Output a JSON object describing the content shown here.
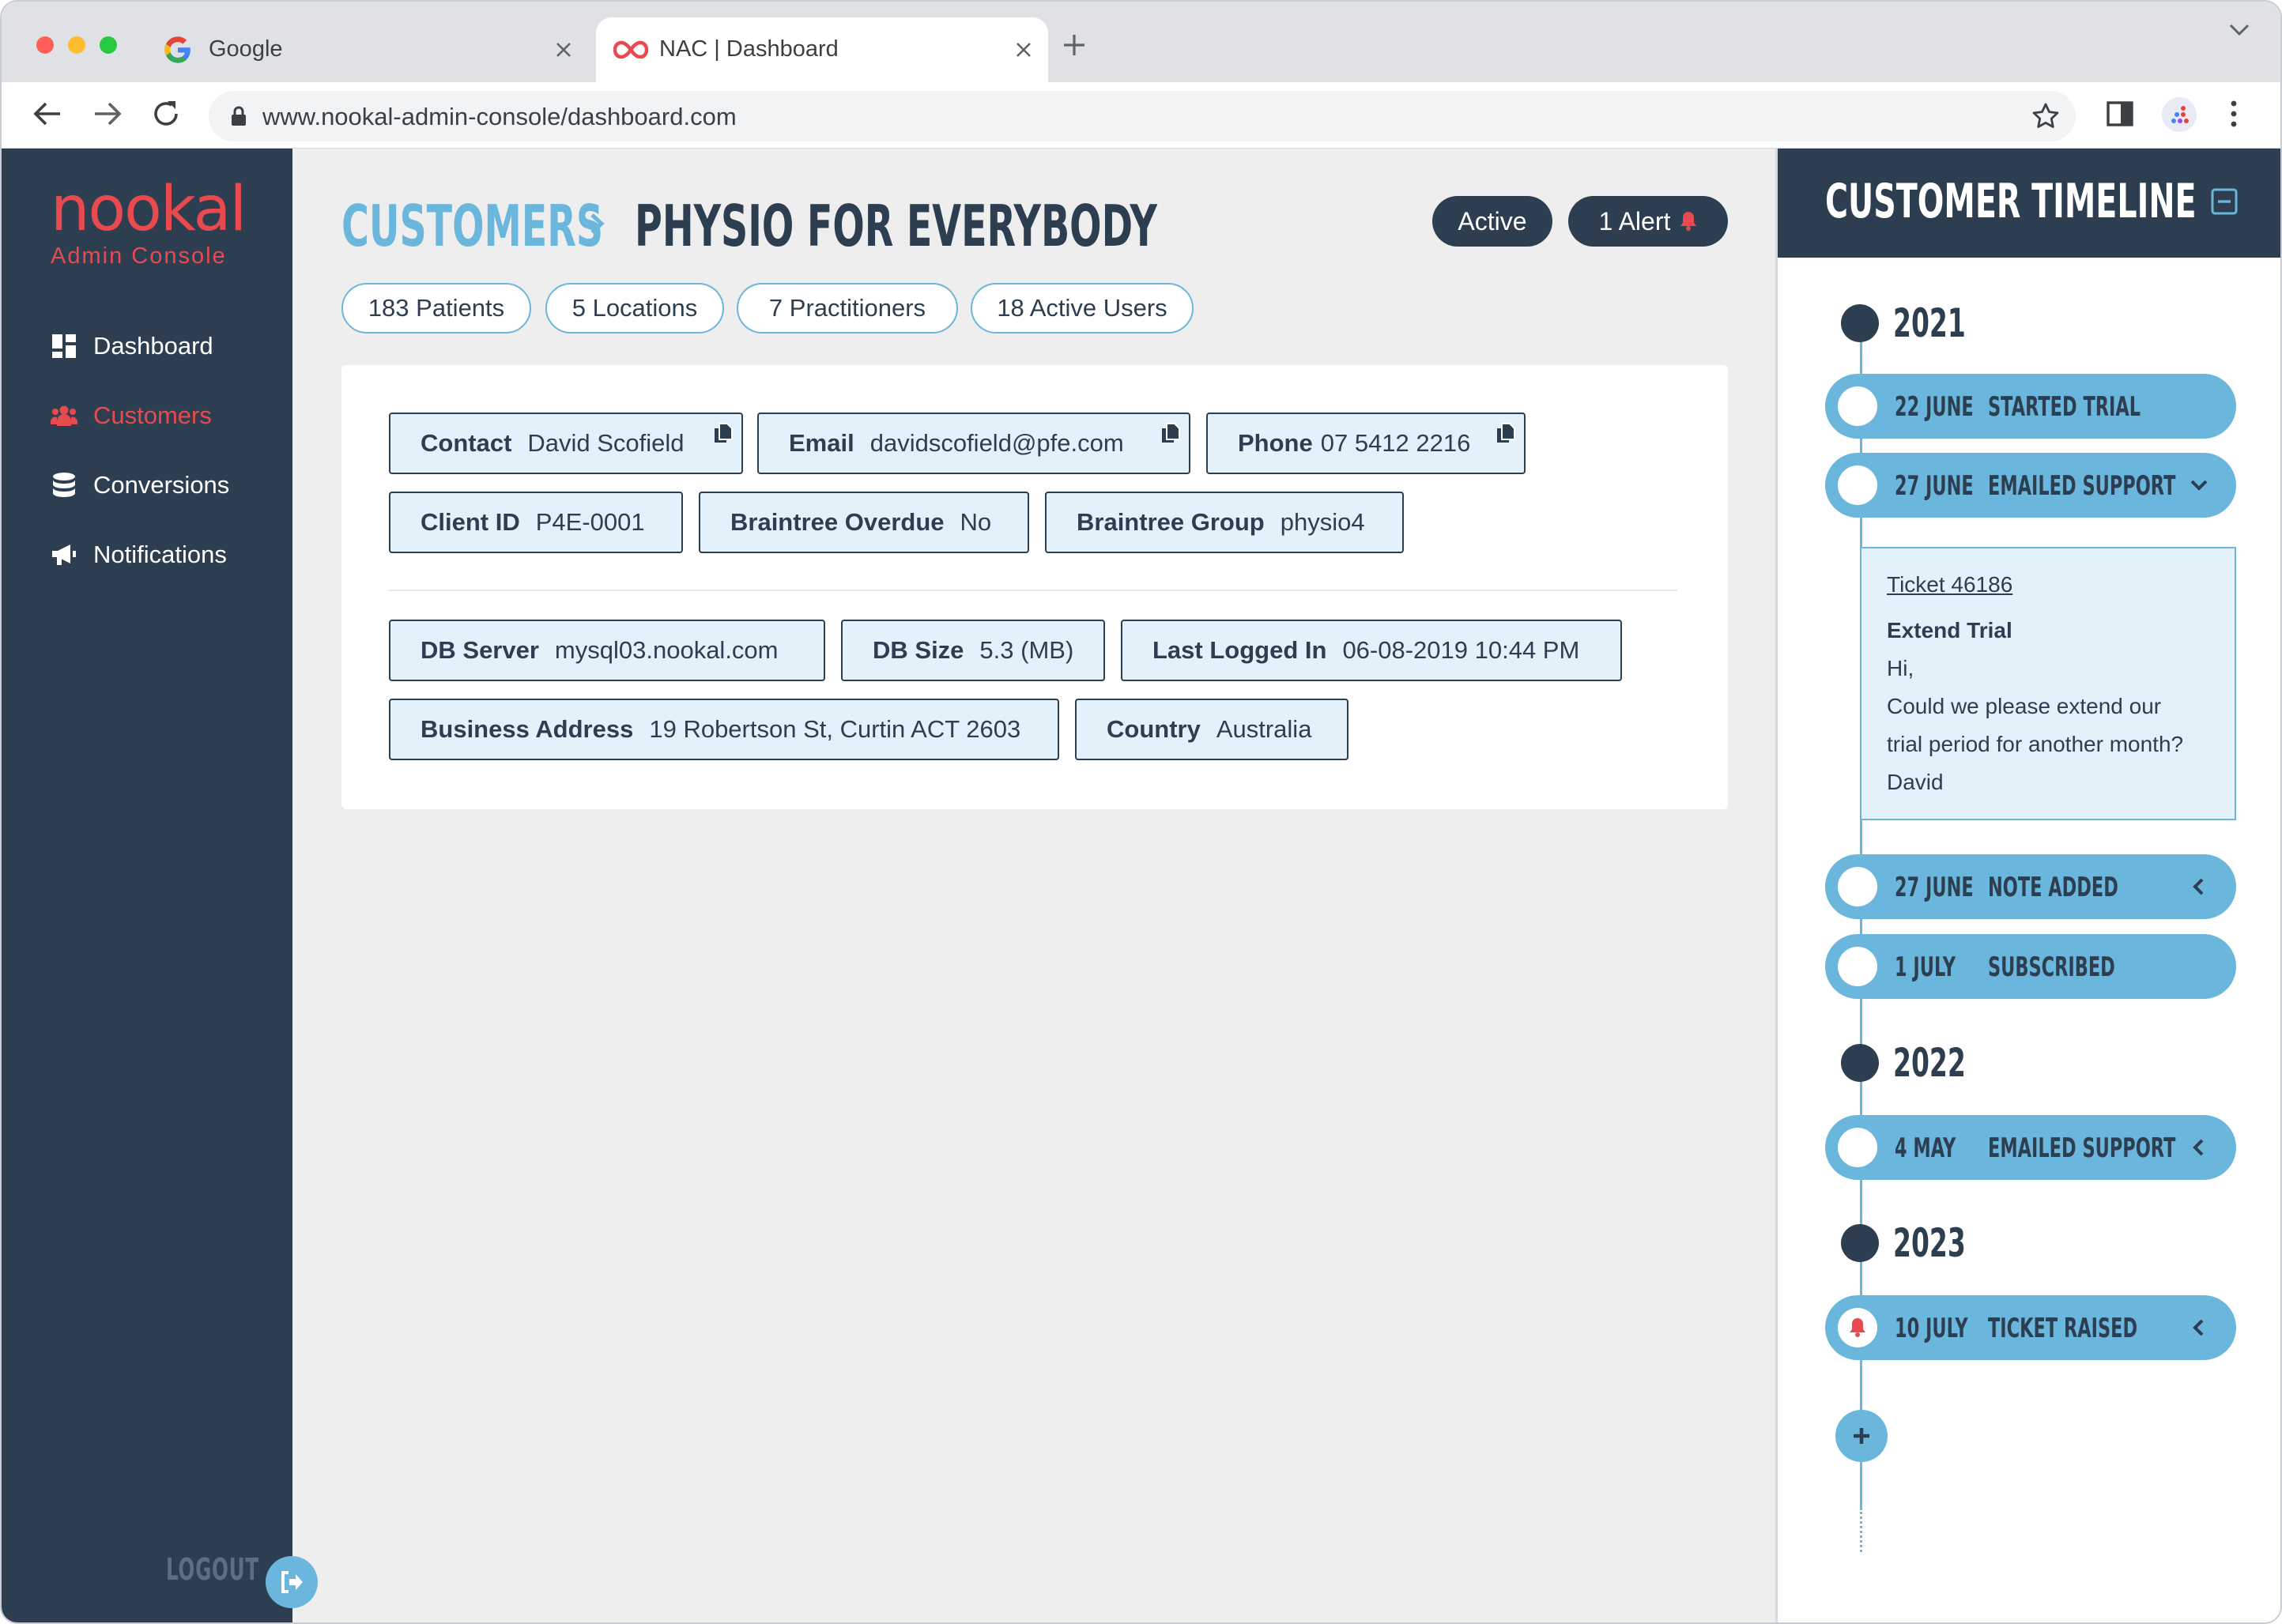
{
  "browser": {
    "tabs": [
      {
        "title": "Google",
        "favicon": "google-icon",
        "active": false
      },
      {
        "title": "NAC | Dashboard",
        "favicon": "infinity-icon",
        "active": true
      }
    ],
    "url": "www.nookal-admin-console/dashboard.com"
  },
  "sidebar": {
    "logo": {
      "name": "nookal",
      "subtitle": "Admin Console"
    },
    "items": [
      {
        "label": "Dashboard",
        "icon": "dashboard-grid-icon",
        "active": false
      },
      {
        "label": "Customers",
        "icon": "users-icon",
        "active": true
      },
      {
        "label": "Conversions",
        "icon": "database-icon",
        "active": false
      },
      {
        "label": "Notifications",
        "icon": "megaphone-icon",
        "active": false
      }
    ],
    "logout_label": "LOGOUT"
  },
  "header": {
    "breadcrumb_root": "CUSTOMERS",
    "breadcrumb_current": "PHYSIO FOR EVERYBODY",
    "status_label": "Active",
    "alert_label": "1 Alert"
  },
  "stats": [
    "183 Patients",
    "5 Locations",
    "7 Practitioners",
    "18 Active Users"
  ],
  "details": {
    "contact": {
      "label": "Contact",
      "value": "David Scofield"
    },
    "email": {
      "label": "Email",
      "value": "davidscofield@pfe.com"
    },
    "phone": {
      "label": "Phone",
      "value": "07 5412 2216"
    },
    "client_id": {
      "label": "Client ID",
      "value": "P4E-0001"
    },
    "braintree_overdue": {
      "label": "Braintree Overdue",
      "value": "No"
    },
    "braintree_group": {
      "label": "Braintree Group",
      "value": "physio4"
    },
    "db_server": {
      "label": "DB Server",
      "value": "mysql03.nookal.com"
    },
    "db_size": {
      "label": "DB Size",
      "value": "5.3 (MB)"
    },
    "last_logged_in": {
      "label": "Last Logged In",
      "value": "06-08-2019 10:44 PM"
    },
    "business_address": {
      "label": "Business Address",
      "value": "19 Robertson St, Curtin ACT 2603"
    },
    "country": {
      "label": "Country",
      "value": "Australia"
    }
  },
  "timeline": {
    "title": "CUSTOMER TIMELINE",
    "years": [
      "2021",
      "2022",
      "2023"
    ],
    "events": [
      {
        "date": "22 JUNE",
        "label": "STARTED TRIAL"
      },
      {
        "date": "27 JUNE",
        "label": "EMAILED SUPPORT",
        "expanded": true
      },
      {
        "date": "27 JUNE",
        "label": "NOTE ADDED"
      },
      {
        "date": "1 JULY",
        "label": "SUBSCRIBED"
      },
      {
        "date": "4 MAY",
        "label": "EMAILED SUPPORT"
      },
      {
        "date": "10 JULY",
        "label": "TICKET RAISED",
        "alert": true
      }
    ],
    "ticket": {
      "link": "Ticket 46186",
      "subject": "Extend Trial",
      "lines": [
        "Hi,",
        "Could we please extend our",
        "trial period for another month?",
        "David"
      ]
    }
  },
  "colors": {
    "navy": "#2c3e50",
    "brand_red": "#e84a4f",
    "accent_blue": "#6bb6dc",
    "chip_bg": "#e3f1fa"
  }
}
